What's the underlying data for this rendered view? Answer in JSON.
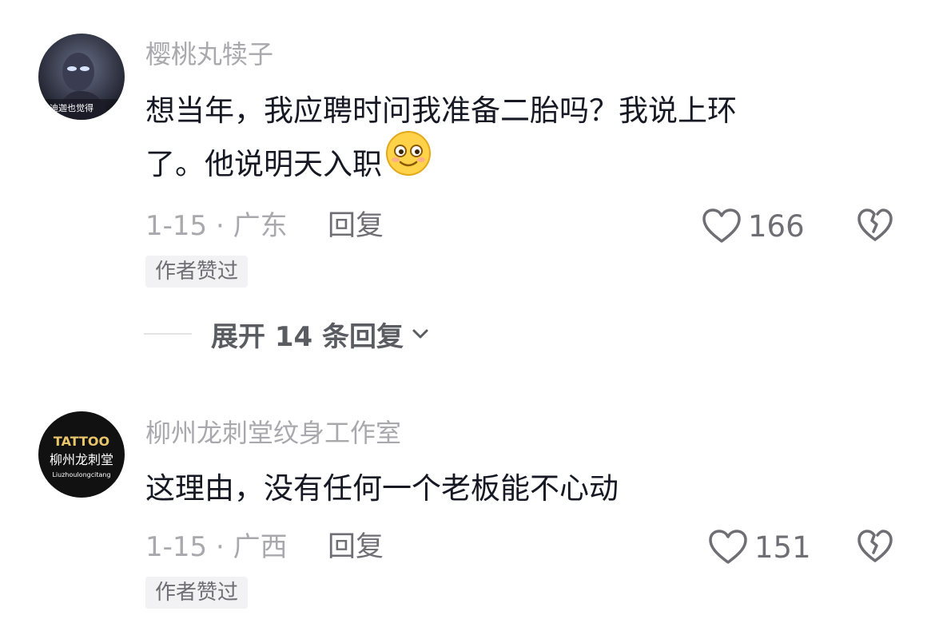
{
  "comments": [
    {
      "avatar_caption": "迪迦也觉得",
      "username": "樱桃丸犊子",
      "text_line1": "想当年，我应聘时问我准备二胎吗？我说上环",
      "text_line2": "了。他说明天入职",
      "emoji": "smiling-face-emoji",
      "date_location": "1-15 · 广东",
      "reply_label": "回复",
      "like_count": "166",
      "badge": "作者赞过"
    },
    {
      "avatar_line1": "TATTOO",
      "avatar_line2": "柳州龙刺堂",
      "avatar_line3": "Liuzhoulongcitang",
      "username": "柳州龙刺堂纹身工作室",
      "text_line1": "这理由，没有任何一个老板能不心动",
      "date_location": "1-15 · 广西",
      "reply_label": "回复",
      "like_count": "151",
      "badge": "作者赞过"
    }
  ],
  "expand_replies": {
    "label": "展开 14 条回复"
  },
  "colors": {
    "text_primary": "#161823",
    "text_secondary": "#a9a9ad",
    "text_tertiary": "#6e6e74",
    "badge_bg": "#f2f2f4"
  }
}
